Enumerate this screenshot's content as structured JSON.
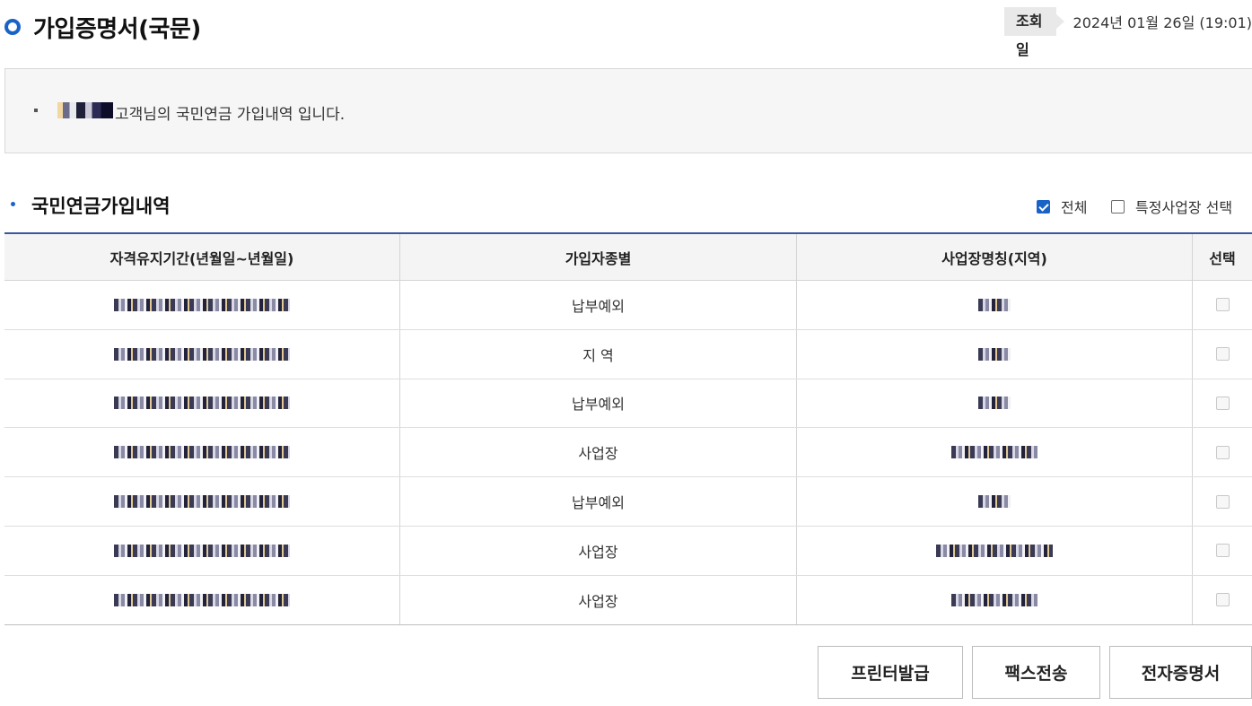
{
  "page": {
    "title": "가입증명서(국문)",
    "query_date_label": "조회일",
    "query_date_value": "2024년 01월 26일 (19:01)"
  },
  "info": {
    "text": "고객님의 국민연금 가입내역 입니다."
  },
  "section": {
    "title": "국민연금가입내역",
    "filter_all_label": "전체",
    "filter_all_checked": true,
    "filter_specific_label": "특정사업장 선택",
    "filter_specific_checked": false
  },
  "table": {
    "headers": [
      "자격유지기간(년월일~년월일)",
      "가입자종별",
      "사업장명칭(지역)",
      "선택"
    ],
    "rows": [
      {
        "type": "납부예외"
      },
      {
        "type": "지 역"
      },
      {
        "type": "납부예외"
      },
      {
        "type": "사업장"
      },
      {
        "type": "납부예외"
      },
      {
        "type": "사업장"
      },
      {
        "type": "사업장"
      }
    ]
  },
  "buttons": {
    "print": "프린터발급",
    "fax": "팩스전송",
    "electronic": "전자증명서"
  },
  "colors": {
    "accent": "#1a63c6",
    "table_top_border": "#3a56a0",
    "header_bg": "#f4f4f4"
  }
}
